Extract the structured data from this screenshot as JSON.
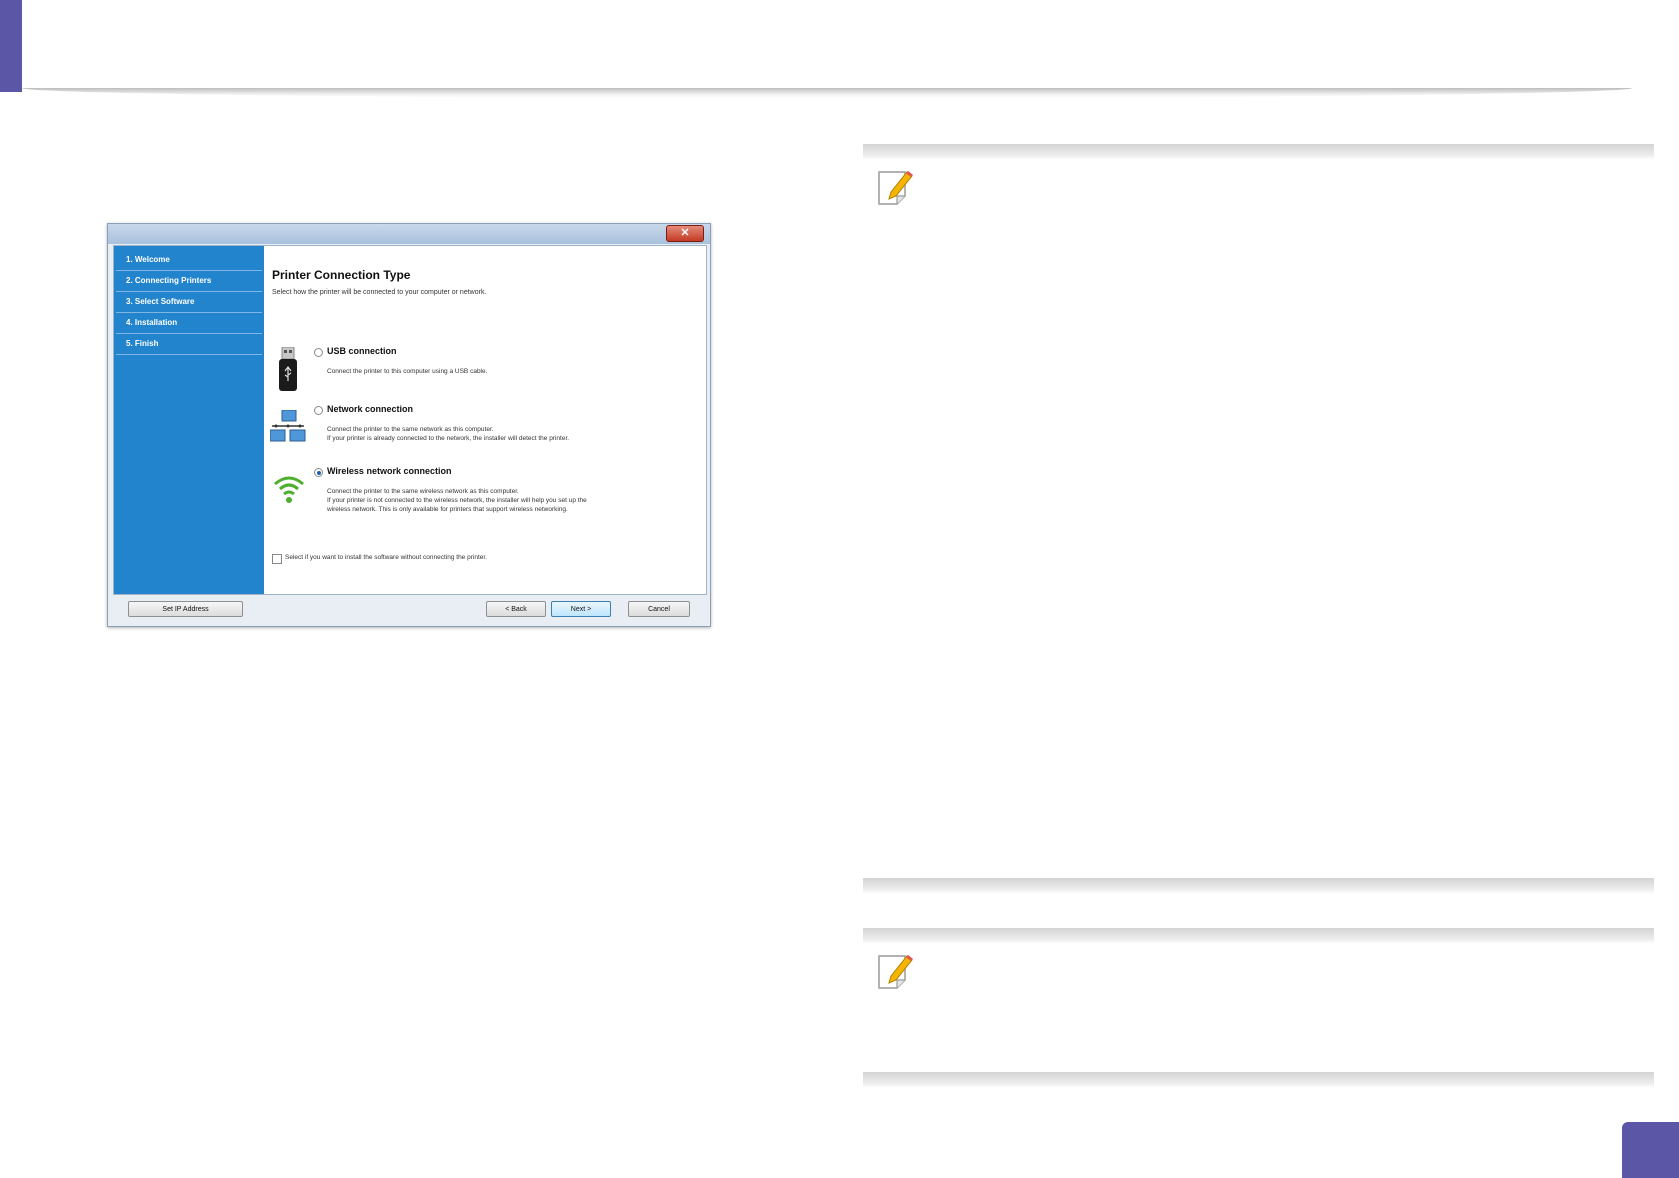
{
  "dialog": {
    "close_label": "✕",
    "steps": [
      "1. Welcome",
      "2. Connecting Printers",
      "3. Select Software",
      "4. Installation",
      "5. Finish"
    ],
    "title": "Printer Connection Type",
    "subtitle": "Select how the printer will be connected to your computer or network.",
    "options": [
      {
        "label": "USB connection",
        "selected": false,
        "icon": "usb-icon",
        "desc_lines": [
          "Connect the printer to this computer using a USB cable."
        ]
      },
      {
        "label": "Network connection",
        "selected": false,
        "icon": "network-icon",
        "desc_lines": [
          "Connect the printer to the same network as this computer.",
          "If your printer is already connected to the network, the installer will detect the printer."
        ]
      },
      {
        "label": "Wireless network connection",
        "selected": true,
        "icon": "wifi-icon",
        "desc_lines": [
          "Connect the printer to the same wireless network as this computer.",
          "If your printer is not connected to the wireless network, the installer will help you set up the",
          "wireless network. This is only available for printers that support wireless networking."
        ]
      }
    ],
    "checkbox_label": "Select if you want to install the software without connecting the printer.",
    "buttons": {
      "set_ip": "Set IP Address",
      "back": "< Back",
      "next": "Next >",
      "cancel": "Cancel"
    }
  },
  "colors": {
    "accent": "#5b57a6",
    "sidebar": "#2284cc",
    "note_pencil": "#f4b400"
  }
}
